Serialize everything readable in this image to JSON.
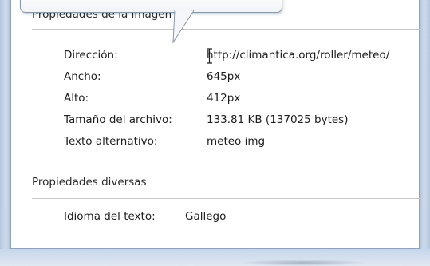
{
  "image_properties": {
    "section_title": "Propiedades de la imagen",
    "rows": [
      {
        "label": "Dirección:",
        "value": "http://climantica.org/roller/meteo/"
      },
      {
        "label": "Ancho:",
        "value": "645px"
      },
      {
        "label": "Alto:",
        "value": "412px"
      },
      {
        "label": "Tamaño del archivo:",
        "value": "133.81 KB (137025 bytes)"
      },
      {
        "label": "Texto alternativo:",
        "value": "meteo img"
      }
    ]
  },
  "misc_properties": {
    "section_title": "Propiedades diversas",
    "rows": [
      {
        "label": "Idioma del texto:",
        "value": "Gallego"
      }
    ]
  }
}
